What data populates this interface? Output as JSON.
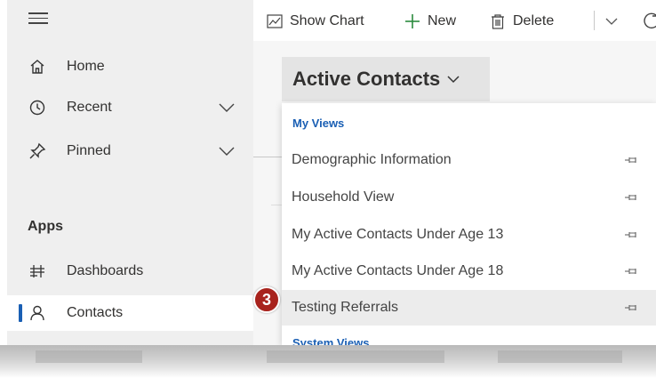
{
  "sidebar": {
    "menu_icon": "hamburger-icon",
    "items": [
      {
        "label": "Home",
        "icon": "home-icon"
      },
      {
        "label": "Recent",
        "icon": "clock-icon",
        "expandable": true
      },
      {
        "label": "Pinned",
        "icon": "pin-icon",
        "expandable": true
      }
    ],
    "apps_heading": "Apps",
    "apps": [
      {
        "label": "Dashboards",
        "icon": "dashboard-icon"
      },
      {
        "label": "Contacts",
        "icon": "person-icon",
        "selected": true
      }
    ]
  },
  "commandbar": {
    "show_chart": "Show Chart",
    "new": "New",
    "delete": "Delete"
  },
  "view_selector": {
    "label": "Active Contacts"
  },
  "dropdown": {
    "my_views_heading": "My Views",
    "items": [
      "Demographic Information",
      "Household View",
      "My Active Contacts Under Age 13",
      "My Active Contacts Under Age 18",
      "Testing Referrals"
    ],
    "highlighted_index": 4,
    "system_views_heading": "System Views"
  },
  "callout": {
    "number": "3",
    "color": "#a8231d"
  },
  "colors": {
    "accent": "#1a5fb4",
    "sidebar_bg": "#efefef",
    "selected_item_bg": "#ffffff"
  }
}
